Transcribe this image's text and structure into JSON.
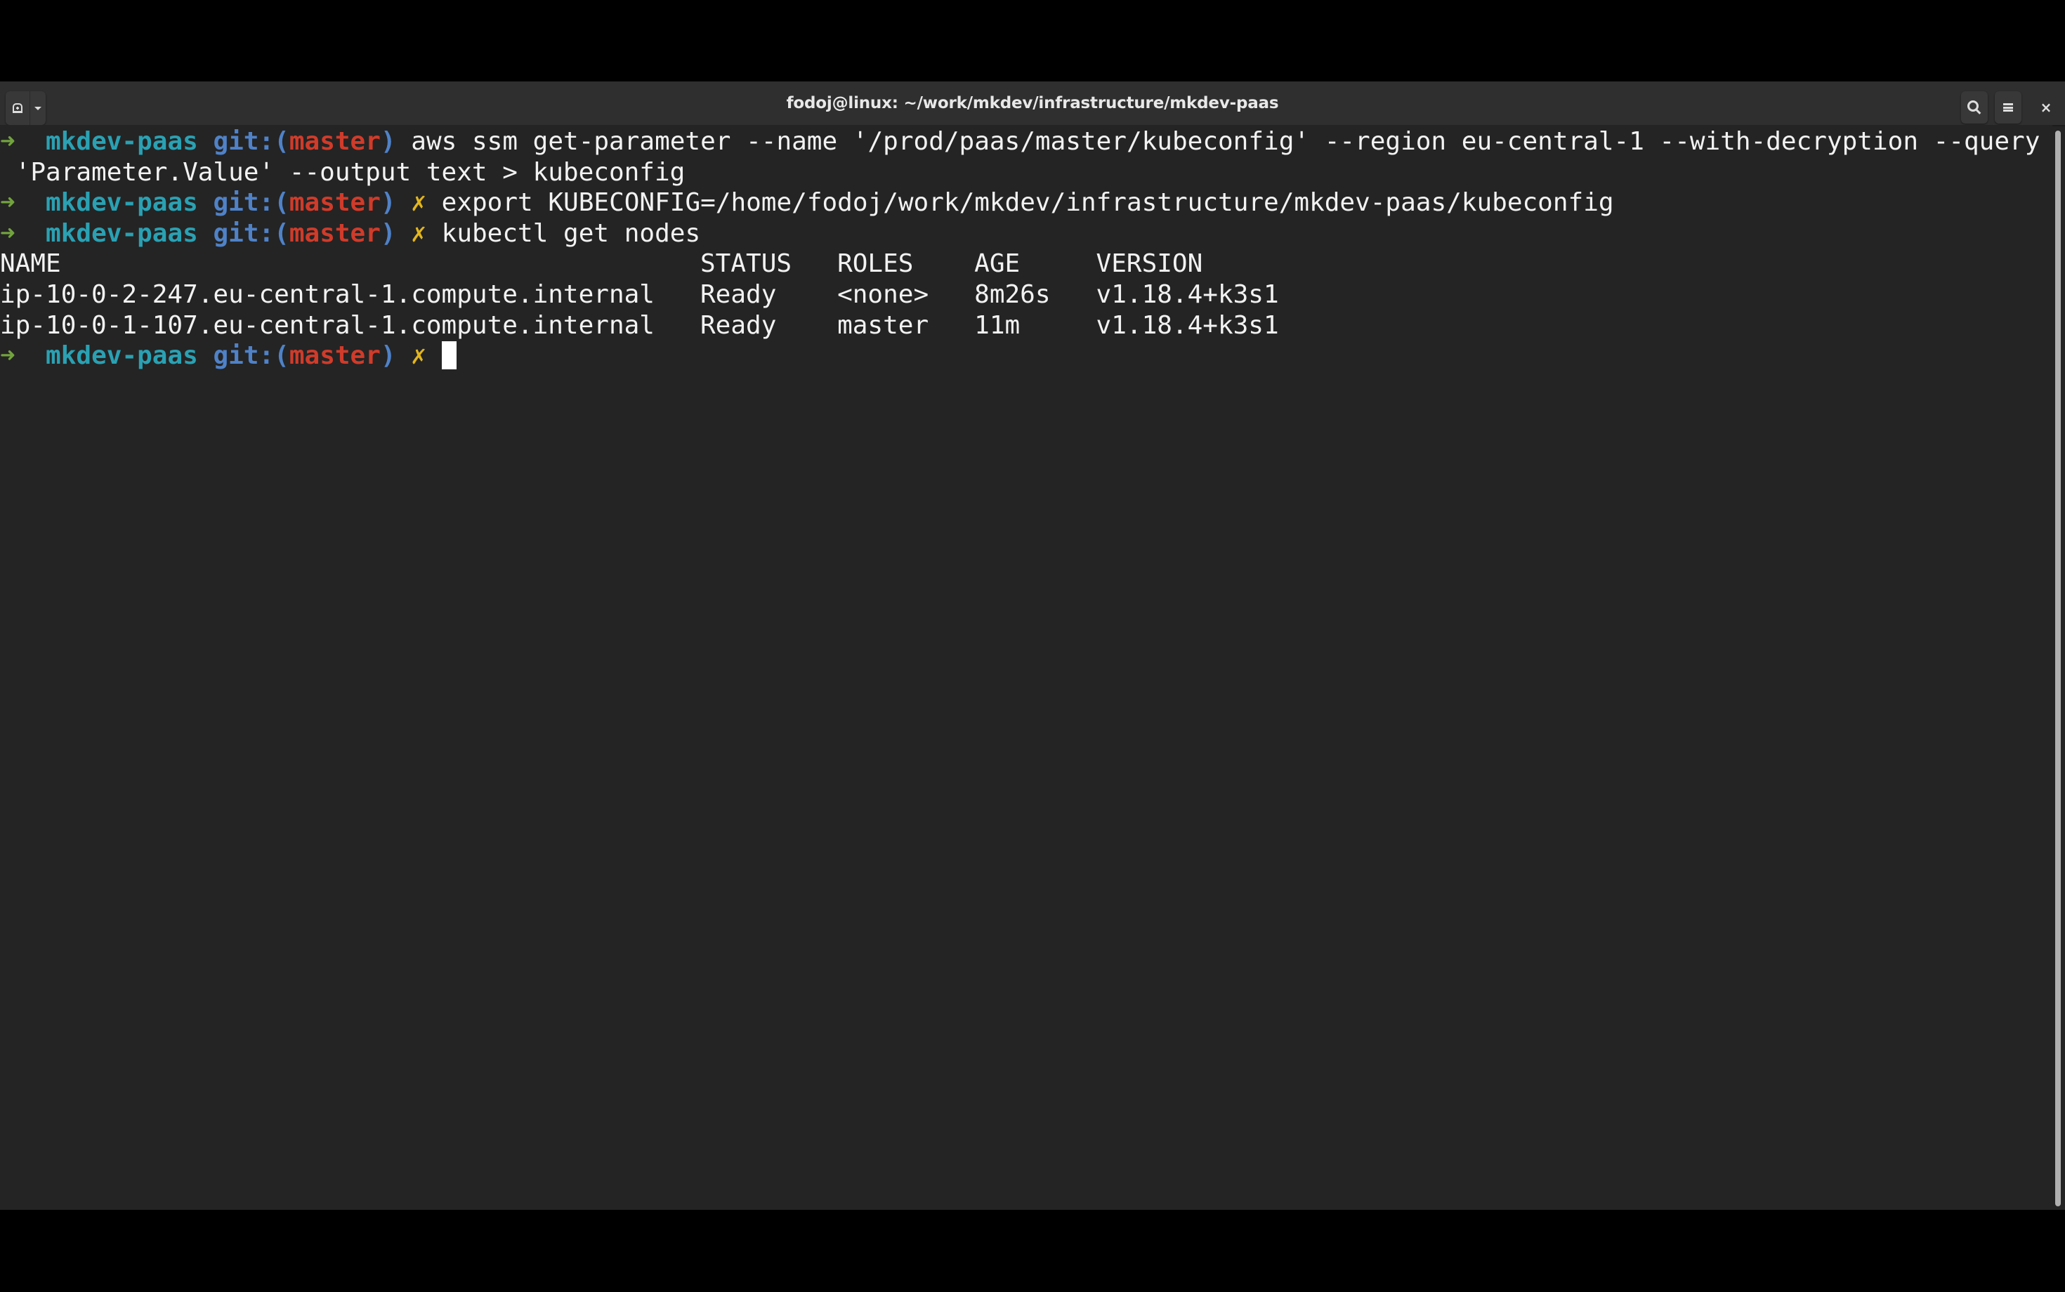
{
  "window": {
    "title": "fodoj@linux: ~/work/mkdev/infrastructure/mkdev-paas",
    "buttons": {
      "new_tab_icon": "new-tab-icon",
      "new_tab_menu_icon": "chevron-down-icon",
      "search_icon": "search-icon",
      "menu_icon": "hamburger-menu-icon",
      "close_label": "×"
    }
  },
  "prompt": {
    "arrow": "➜",
    "directory": "mkdev-paas",
    "git_prefix": "git:(",
    "branch": "master",
    "git_suffix": ")",
    "dirty_marker": "✗"
  },
  "colors": {
    "arrow": "#72a33d",
    "directory": "#2aa1b3",
    "git": "#4f82c8",
    "branch": "#d03b2a",
    "dirty": "#e3b61c",
    "background": "#242424",
    "foreground": "#f2f2f2"
  },
  "commands": [
    {
      "dirty": false,
      "text": "aws ssm get-parameter --name '/prod/paas/master/kubeconfig' --region eu-central-1 --with-decryption --query",
      "continuation": " 'Parameter.Value' --output text > kubeconfig"
    },
    {
      "dirty": true,
      "text": "export KUBECONFIG=/home/fodoj/work/mkdev/infrastructure/mkdev-paas/kubeconfig"
    },
    {
      "dirty": true,
      "text": "kubectl get nodes"
    }
  ],
  "nodes_table": {
    "headers": [
      "NAME",
      "STATUS",
      "ROLES",
      "AGE",
      "VERSION"
    ],
    "rows": [
      [
        "ip-10-0-2-247.eu-central-1.compute.internal",
        "Ready",
        "<none>",
        "8m26s",
        "v1.18.4+k3s1"
      ],
      [
        "ip-10-0-1-107.eu-central-1.compute.internal",
        "Ready",
        "master",
        "11m",
        "v1.18.4+k3s1"
      ]
    ]
  },
  "current_input": ""
}
